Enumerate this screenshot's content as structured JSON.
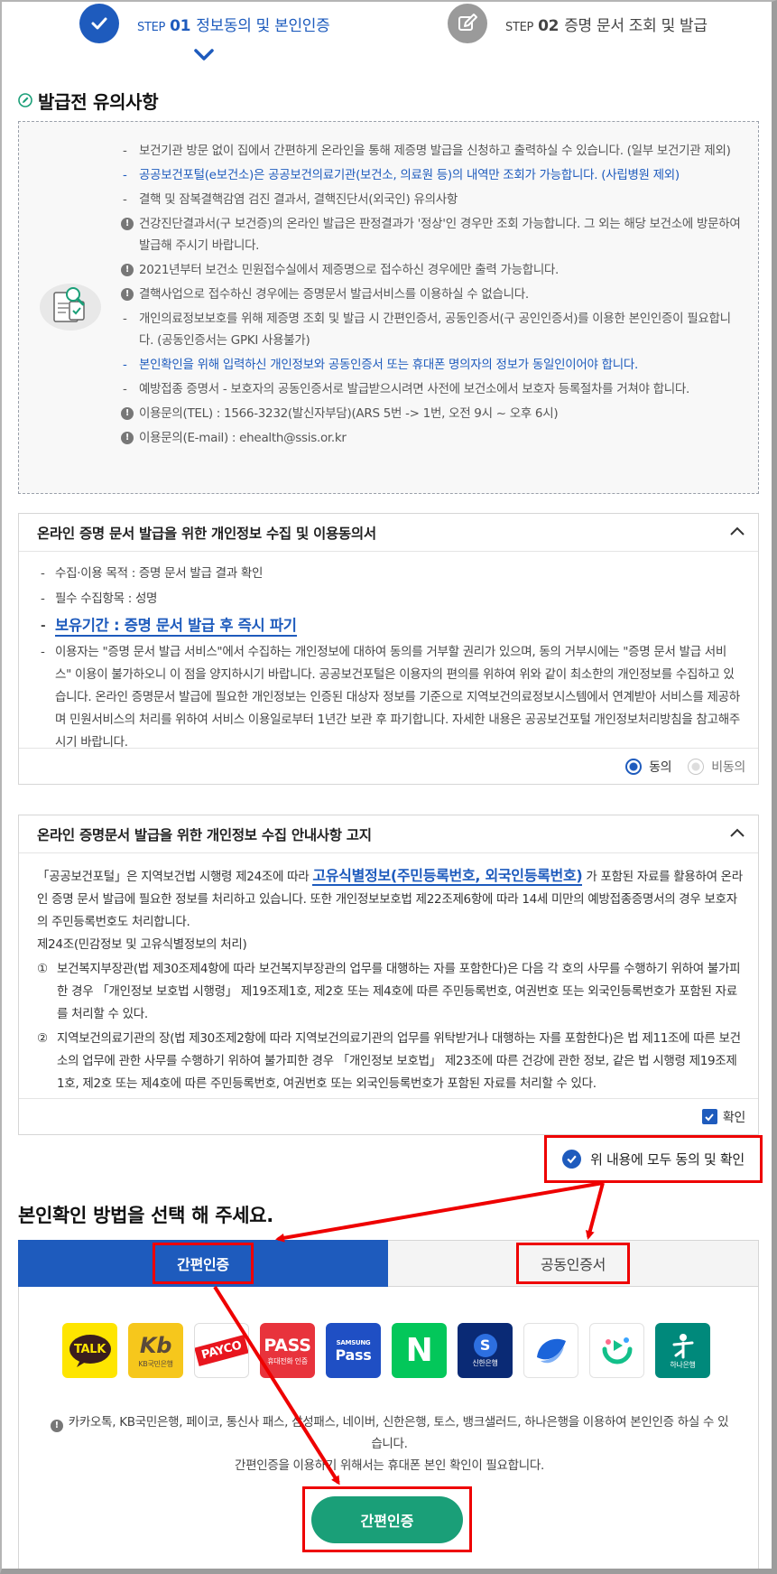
{
  "steps": [
    {
      "step_label": "STEP",
      "step_no": "01",
      "title": "정보동의 및 본인인증",
      "state": "active"
    },
    {
      "step_label": "STEP",
      "step_no": "02",
      "title": "증명 문서 조회 및 발급",
      "state": "inactive"
    }
  ],
  "notice": {
    "title": "발급전 유의사항",
    "items": [
      "보건기관 방문 없이 집에서 간편하게 온라인을 통해 제증명 발급을 신청하고 출력하실 수 있습니다. (일부 보건기관 제외)",
      "공공보건포털(e보건소)은 공공보건의료기관(보건소, 의료원 등)의 내역만 조회가 가능합니다. (사립병원 제외)",
      "결핵 및 잠복결핵감염 검진 결과서, 결핵진단서(외국인) 유의사항",
      "건강진단결과서(구 보건증)의 온라인 발급은 판정결과가 '정상'인 경우만 조회 가능합니다. 그 외는 해당 보건소에 방문하여 발급해 주시기 바랍니다.",
      "2021년부터 보건소 민원접수실에서 제증명으로 접수하신 경우에만 출력 가능합니다.",
      "결핵사업으로 접수하신 경우에는 증명문서 발급서비스를 이용하실 수 없습니다.",
      "개인의료정보보호를 위해 제증명 조회 및 발급 시 간편인증서, 공동인증서(구 공인인증서)를 이용한 본인인증이 필요합니다. (공동인증서는 GPKI 사용불가)",
      "본인확인을 위해 입력하신 개인정보와 공동인증서 또는 휴대폰 명의자의 정보가 동일인이어야 합니다.",
      "예방접종 증명서 - 보호자의 공동인증서로 발급받으시려면 사전에 보건소에서 보호자 등록절차를 거쳐야 합니다.",
      "이용문의(TEL) : 1566-3232(발신자부담)(ARS 5번 -> 1번, 오전 9시 ~ 오후 6시)",
      "이용문의(E-mail) : ehealth@ssis.or.kr"
    ]
  },
  "consent1": {
    "title": "온라인 증명 문서 발급을 위한 개인정보 수집 및 이용동의서",
    "items": [
      "수집·이용 목적 : 증명 문서 발급 결과 확인",
      "필수 수집항목 : 성명",
      "보유기간 : 증명 문서 발급 후 즉시 파기",
      "이용자는 \"증명 문서 발급 서비스\"에서 수집하는 개인정보에 대하여 동의를 거부할 권리가 있으며, 동의 거부시에는 \"증명 문서 발급 서비스\" 이용이 불가하오니 이 점을 양지하시기 바랍니다. 공공보건포털은 이용자의 편의를 위하여 위와 같이 최소한의 개인정보를 수집하고 있습니다. 온라인 증명문서 발급에 필요한 개인정보는 인증된 대상자 정보를 기준으로 지역보건의료정보시스템에서 연계받아 서비스를 제공하며 민원서비스의 처리를 위하여 서비스 이용일로부터 1년간 보관 후 파기합니다. 자세한 내용은 공공보건포털 개인정보처리방침을 참고해주시기 바랍니다."
    ],
    "agree_label": "동의",
    "disagree_label": "비동의"
  },
  "consent2": {
    "title": "온라인 증명문서 발급을 위한 개인정보 수집 안내사항 고지",
    "para_pre": "「공공보건포털」은 지역보건법 시행령 제24조에 따라 ",
    "para_hl": "고유식별정보(주민등록번호, 외국인등록번호)",
    "para_post": " 가 포함된 자료를 활용하여 온라인 증명 문서 발급에 필요한 정보를 처리하고 있습니다. 또한 개인정보보호법 제22조제6항에 따라 14세 미만의 예방접종증명서의 경우 보호자의 주민등록번호도 처리합니다.",
    "article": "제24조(민감정보 및 고유식별정보의 처리)",
    "ol": [
      {
        "num": "①",
        "text": "보건복지부장관(법 제30조제4항에 따라 보건복지부장관의 업무를 대행하는 자를 포함한다)은 다음 각 호의 사무를 수행하기 위하여 불가피한 경우 「개인정보 보호법 시행령」 제19조제1호, 제2호 또는 제4호에 따른 주민등록번호, 여권번호 또는 외국인등록번호가 포함된 자료를 처리할 수 있다."
      },
      {
        "num": "②",
        "text": "지역보건의료기관의 장(법 제30조제2항에 따라 지역보건의료기관의 업무를 위탁받거나 대행하는 자를 포함한다)은 법 제11조에 따른 보건소의 업무에 관한 사무를 수행하기 위하여 불가피한 경우 「개인정보 보호법」 제23조에 따른 건강에 관한 정보, 같은 법 시행령 제19조제1호, 제2호 또는 제4호에 따른 주민등록번호, 여권번호 또는 외국인등록번호가 포함된 자료를 처리할 수 있다."
      }
    ],
    "confirm_label": "확인"
  },
  "agree_all_label": "위 내용에 모두 동의 및 확인",
  "auth": {
    "title": "본인확인 방법을 선택 해 주세요.",
    "tabs": [
      {
        "label": "간편인증",
        "active": true
      },
      {
        "label": "공동인증서",
        "active": false
      }
    ],
    "providers": [
      {
        "name": "TALK",
        "sub": "",
        "icon": "kakao-talk-icon",
        "bg": "#fee500",
        "fg": "#3a1d1d"
      },
      {
        "name": "Kb",
        "sub": "KB국민은행",
        "icon": "kb-bank-icon",
        "bg": "#f6c71c",
        "fg": "#5a4a3a"
      },
      {
        "name": "PAYCO",
        "sub": "",
        "icon": "payco-icon",
        "bg": "#ffffff",
        "fg": "#e8161e"
      },
      {
        "name": "PASS",
        "sub": "휴대전화 인증",
        "icon": "pass-icon",
        "bg": "#e8333c",
        "fg": "#ffffff"
      },
      {
        "name": "Pass",
        "sub": "SAMSUNG",
        "icon": "samsung-pass-icon",
        "bg": "#1f4fc4",
        "fg": "#ffffff"
      },
      {
        "name": "N",
        "sub": "",
        "icon": "naver-icon",
        "bg": "#03c75a",
        "fg": "#ffffff"
      },
      {
        "name": "S",
        "sub": "신한은행",
        "icon": "shinhan-bank-icon",
        "bg": "#0a2a75",
        "fg": "#ffffff"
      },
      {
        "name": "",
        "sub": "",
        "icon": "toss-icon",
        "bg": "#ffffff",
        "fg": "#1b64da"
      },
      {
        "name": "",
        "sub": "",
        "icon": "banksalad-icon",
        "bg": "#ffffff",
        "fg": "#13c08a"
      },
      {
        "name": "",
        "sub": "하나은행",
        "icon": "hana-bank-icon",
        "bg": "#00897b",
        "fg": "#ffffff"
      }
    ],
    "note_line1": "카카오톡, KB국민은행, 페이코, 통신사 패스, 삼성패스, 네이버, 신한은행, 토스, 뱅크샐러드, 하나은행을 이용하여 본인인증 하실 수 있습니다.",
    "note_line2": "간편인증을 이용하기 위해서는 휴대폰 본인 확인이 필요합니다.",
    "button_label": "간편인증"
  },
  "colors": {
    "primary": "#1e5bbd",
    "green": "#1a9f78",
    "annotation": "#e00000"
  }
}
